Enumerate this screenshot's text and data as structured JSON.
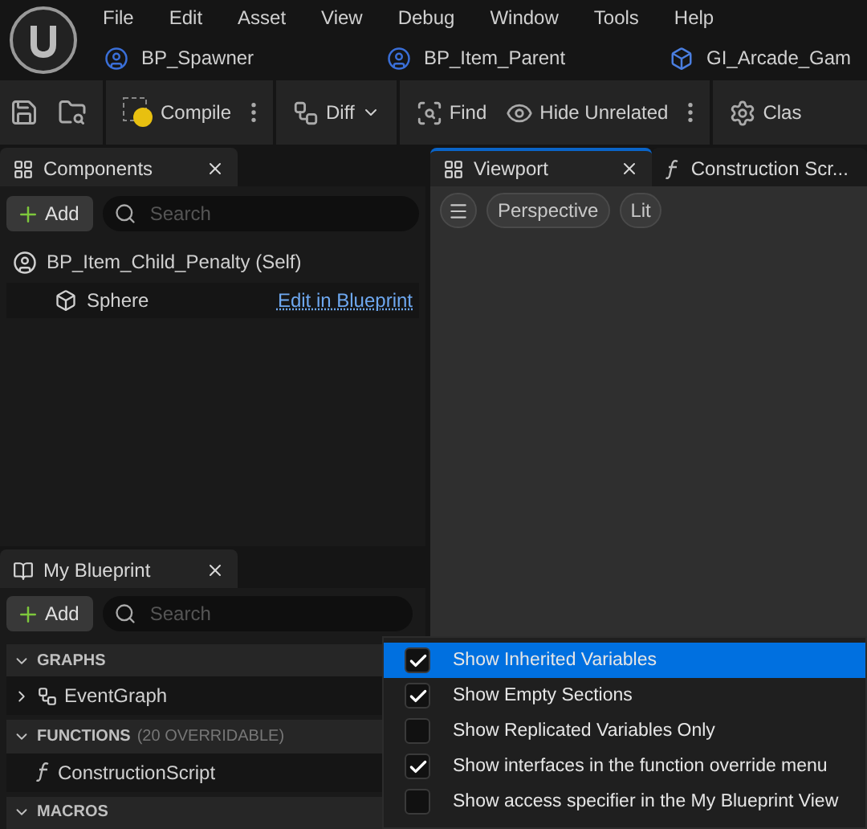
{
  "menu": [
    "File",
    "Edit",
    "Asset",
    "View",
    "Debug",
    "Window",
    "Tools",
    "Help"
  ],
  "doc_tabs": [
    {
      "label": "BP_Spawner",
      "kind": "actor"
    },
    {
      "label": "BP_Item_Parent",
      "kind": "actor"
    },
    {
      "label": "GI_Arcade_Gam",
      "kind": "instance"
    }
  ],
  "toolbar": [
    {
      "kind": "save"
    },
    {
      "kind": "browse"
    },
    {
      "kind": "compile",
      "label": "Compile"
    },
    {
      "kind": "diff",
      "label": "Diff"
    },
    {
      "kind": "find",
      "label": "Find"
    },
    {
      "kind": "hide",
      "label": "Hide Unrelated"
    },
    {
      "kind": "settings",
      "label": "Clas"
    }
  ],
  "components": {
    "title": "Components",
    "add": "Add",
    "search_placeholder": "Search",
    "tree": [
      {
        "label": "BP_Item_Child_Penalty (Self)",
        "children": [
          {
            "label": "Sphere",
            "link": "Edit in Blueprint"
          }
        ]
      }
    ]
  },
  "viewport": {
    "tabs": [
      {
        "label": "Viewport",
        "selected": true,
        "kind": "viewport"
      },
      {
        "label": "Construction Scr...",
        "selected": false,
        "kind": "function"
      }
    ],
    "buttons": [
      "Perspective",
      "Lit"
    ]
  },
  "my_blueprint": {
    "title": "My Blueprint",
    "add": "Add",
    "search_placeholder": "Search",
    "sections": [
      {
        "title": "GRAPHS",
        "expanded": true,
        "items": [
          {
            "label": "EventGraph",
            "kind": "graph"
          }
        ]
      },
      {
        "title": "FUNCTIONS",
        "note": "(20 OVERRIDABLE)",
        "expanded": true,
        "items": [
          {
            "label": "ConstructionScript",
            "kind": "function"
          }
        ]
      },
      {
        "title": "MACROS",
        "expanded": true
      }
    ]
  },
  "options_menu": [
    {
      "label": "Show Inherited Variables",
      "checked": true,
      "selected": true
    },
    {
      "label": "Show Empty Sections",
      "checked": true,
      "selected": false
    },
    {
      "label": "Show Replicated Variables Only",
      "checked": false,
      "selected": false
    },
    {
      "label": "Show interfaces in the function override menu",
      "checked": true,
      "selected": false
    },
    {
      "label": "Show access specifier in the My Blueprint View",
      "checked": false,
      "selected": false
    }
  ]
}
